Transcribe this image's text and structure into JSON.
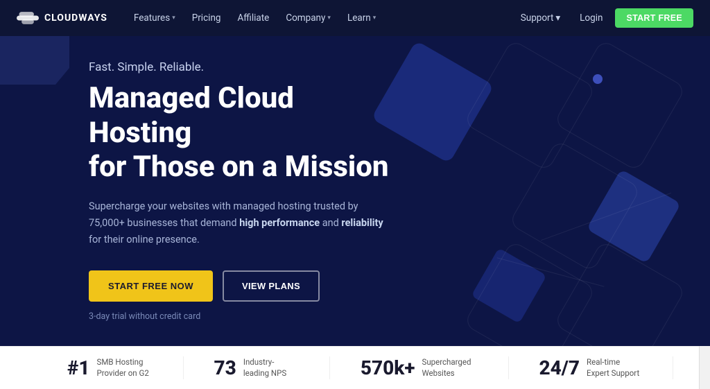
{
  "brand": {
    "name": "CLOUDWAYS",
    "logo_alt": "Cloudways logo"
  },
  "navbar": {
    "links": [
      {
        "label": "Features",
        "has_dropdown": true
      },
      {
        "label": "Pricing",
        "has_dropdown": false
      },
      {
        "label": "Affiliate",
        "has_dropdown": false
      },
      {
        "label": "Company",
        "has_dropdown": true
      },
      {
        "label": "Learn",
        "has_dropdown": true
      }
    ],
    "support_label": "Support",
    "login_label": "Login",
    "start_free_label": "START FREE"
  },
  "hero": {
    "tagline": "Fast. Simple. Reliable.",
    "heading_line1": "Managed Cloud Hosting",
    "heading_line2": "for Those on a Mission",
    "description_prefix": "Supercharge your websites with managed hosting trusted by 75,000+ businesses that demand ",
    "description_bold1": "high performance",
    "description_mid": " and ",
    "description_bold2": "reliability",
    "description_suffix": " for their online presence.",
    "cta_primary": "START FREE NOW",
    "cta_secondary": "VIEW PLANS",
    "trial_note": "3-day trial without credit card"
  },
  "stats": [
    {
      "number": "#1",
      "description": "SMB Hosting Provider on G2"
    },
    {
      "number": "73",
      "description": "Industry-leading NPS"
    },
    {
      "number": "570k+",
      "description": "Supercharged Websites"
    },
    {
      "number": "24/7",
      "description": "Real-time Expert Support"
    }
  ]
}
